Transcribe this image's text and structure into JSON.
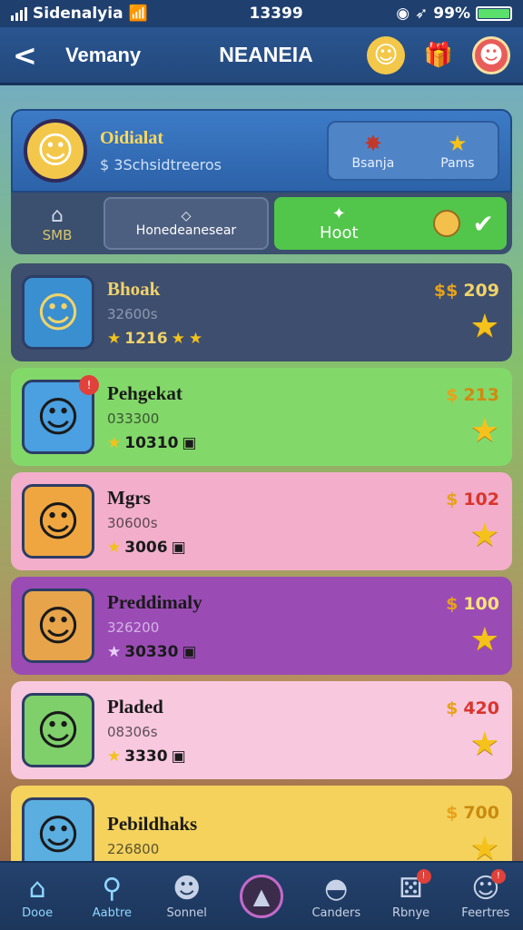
{
  "status_bar": {
    "carrier": "Sidenalyia",
    "time": "13399",
    "battery": "99%",
    "battery_level": 0.99
  },
  "nav": {
    "back": "<",
    "subtitle": "Vemany",
    "title": "NEANEIA"
  },
  "profile": {
    "name": "Oidialat",
    "sub": "$ 3Schsidtreeros",
    "actions": [
      {
        "label": "Bsanja"
      },
      {
        "label": "Pams"
      }
    ]
  },
  "tabs": {
    "home": "SMB",
    "middle": "Honedeanesear",
    "hot": "Hoot"
  },
  "rows": [
    {
      "name": "Bhoak",
      "sub": "32600s",
      "stats": "1216",
      "price": "209",
      "price_prefix": "$$"
    },
    {
      "name": "Pehgekat",
      "sub": "033300",
      "stats": "10310",
      "price": "213",
      "price_prefix": "$"
    },
    {
      "name": "Mgrs",
      "sub": "30600s",
      "stats": "3006",
      "price": "102",
      "price_prefix": "$"
    },
    {
      "name": "Preddimaly",
      "sub": "326200",
      "stats": "30330",
      "price": "100",
      "price_prefix": "$"
    },
    {
      "name": "Pladed",
      "sub": "08306s",
      "stats": "3330",
      "price": "420",
      "price_prefix": "$"
    },
    {
      "name": "Pebildhaks",
      "sub": "226800",
      "stats": "",
      "price": "700",
      "price_prefix": "$"
    }
  ],
  "bottom_nav": [
    {
      "label": "Dooe",
      "icon": "home-icon"
    },
    {
      "label": "Aabtre",
      "icon": "search-icon"
    },
    {
      "label": "Sonnel",
      "icon": "character-icon"
    },
    {
      "label": "",
      "icon": "play-icon"
    },
    {
      "label": "Canders",
      "icon": "bell-icon"
    },
    {
      "label": "Rbnye",
      "icon": "dice-icon"
    },
    {
      "label": "Feertres",
      "icon": "profile-icon"
    }
  ]
}
